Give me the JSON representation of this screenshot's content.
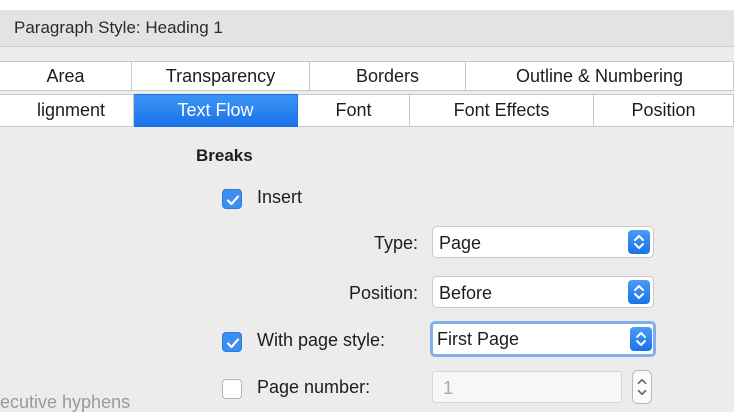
{
  "window": {
    "title": "Paragraph Style: Heading 1"
  },
  "tabs_row1": [
    {
      "label": "Area"
    },
    {
      "label": "Transparency"
    },
    {
      "label": "Borders"
    },
    {
      "label": "Outline & Numbering"
    }
  ],
  "tabs_row2": [
    {
      "label": "lignment"
    },
    {
      "label": "Text Flow",
      "active": true
    },
    {
      "label": "Font"
    },
    {
      "label": "Font Effects"
    },
    {
      "label": "Position"
    }
  ],
  "breaks": {
    "section_title": "Breaks",
    "insert_label": "Insert",
    "insert_checked": true,
    "type_label": "Type:",
    "type_value": "Page",
    "position_label": "Position:",
    "position_value": "Before",
    "with_page_style_label": "With page style:",
    "with_page_style_checked": true,
    "page_style_value": "First Page",
    "page_number_label": "Page number:",
    "page_number_checked": false,
    "page_number_value": "1"
  },
  "cutoff_text": "ecutive hyphens",
  "colors": {
    "accent": "#1a73e8",
    "checkbox_checked": "#3b8ff0",
    "dialog_background": "#ececec"
  }
}
